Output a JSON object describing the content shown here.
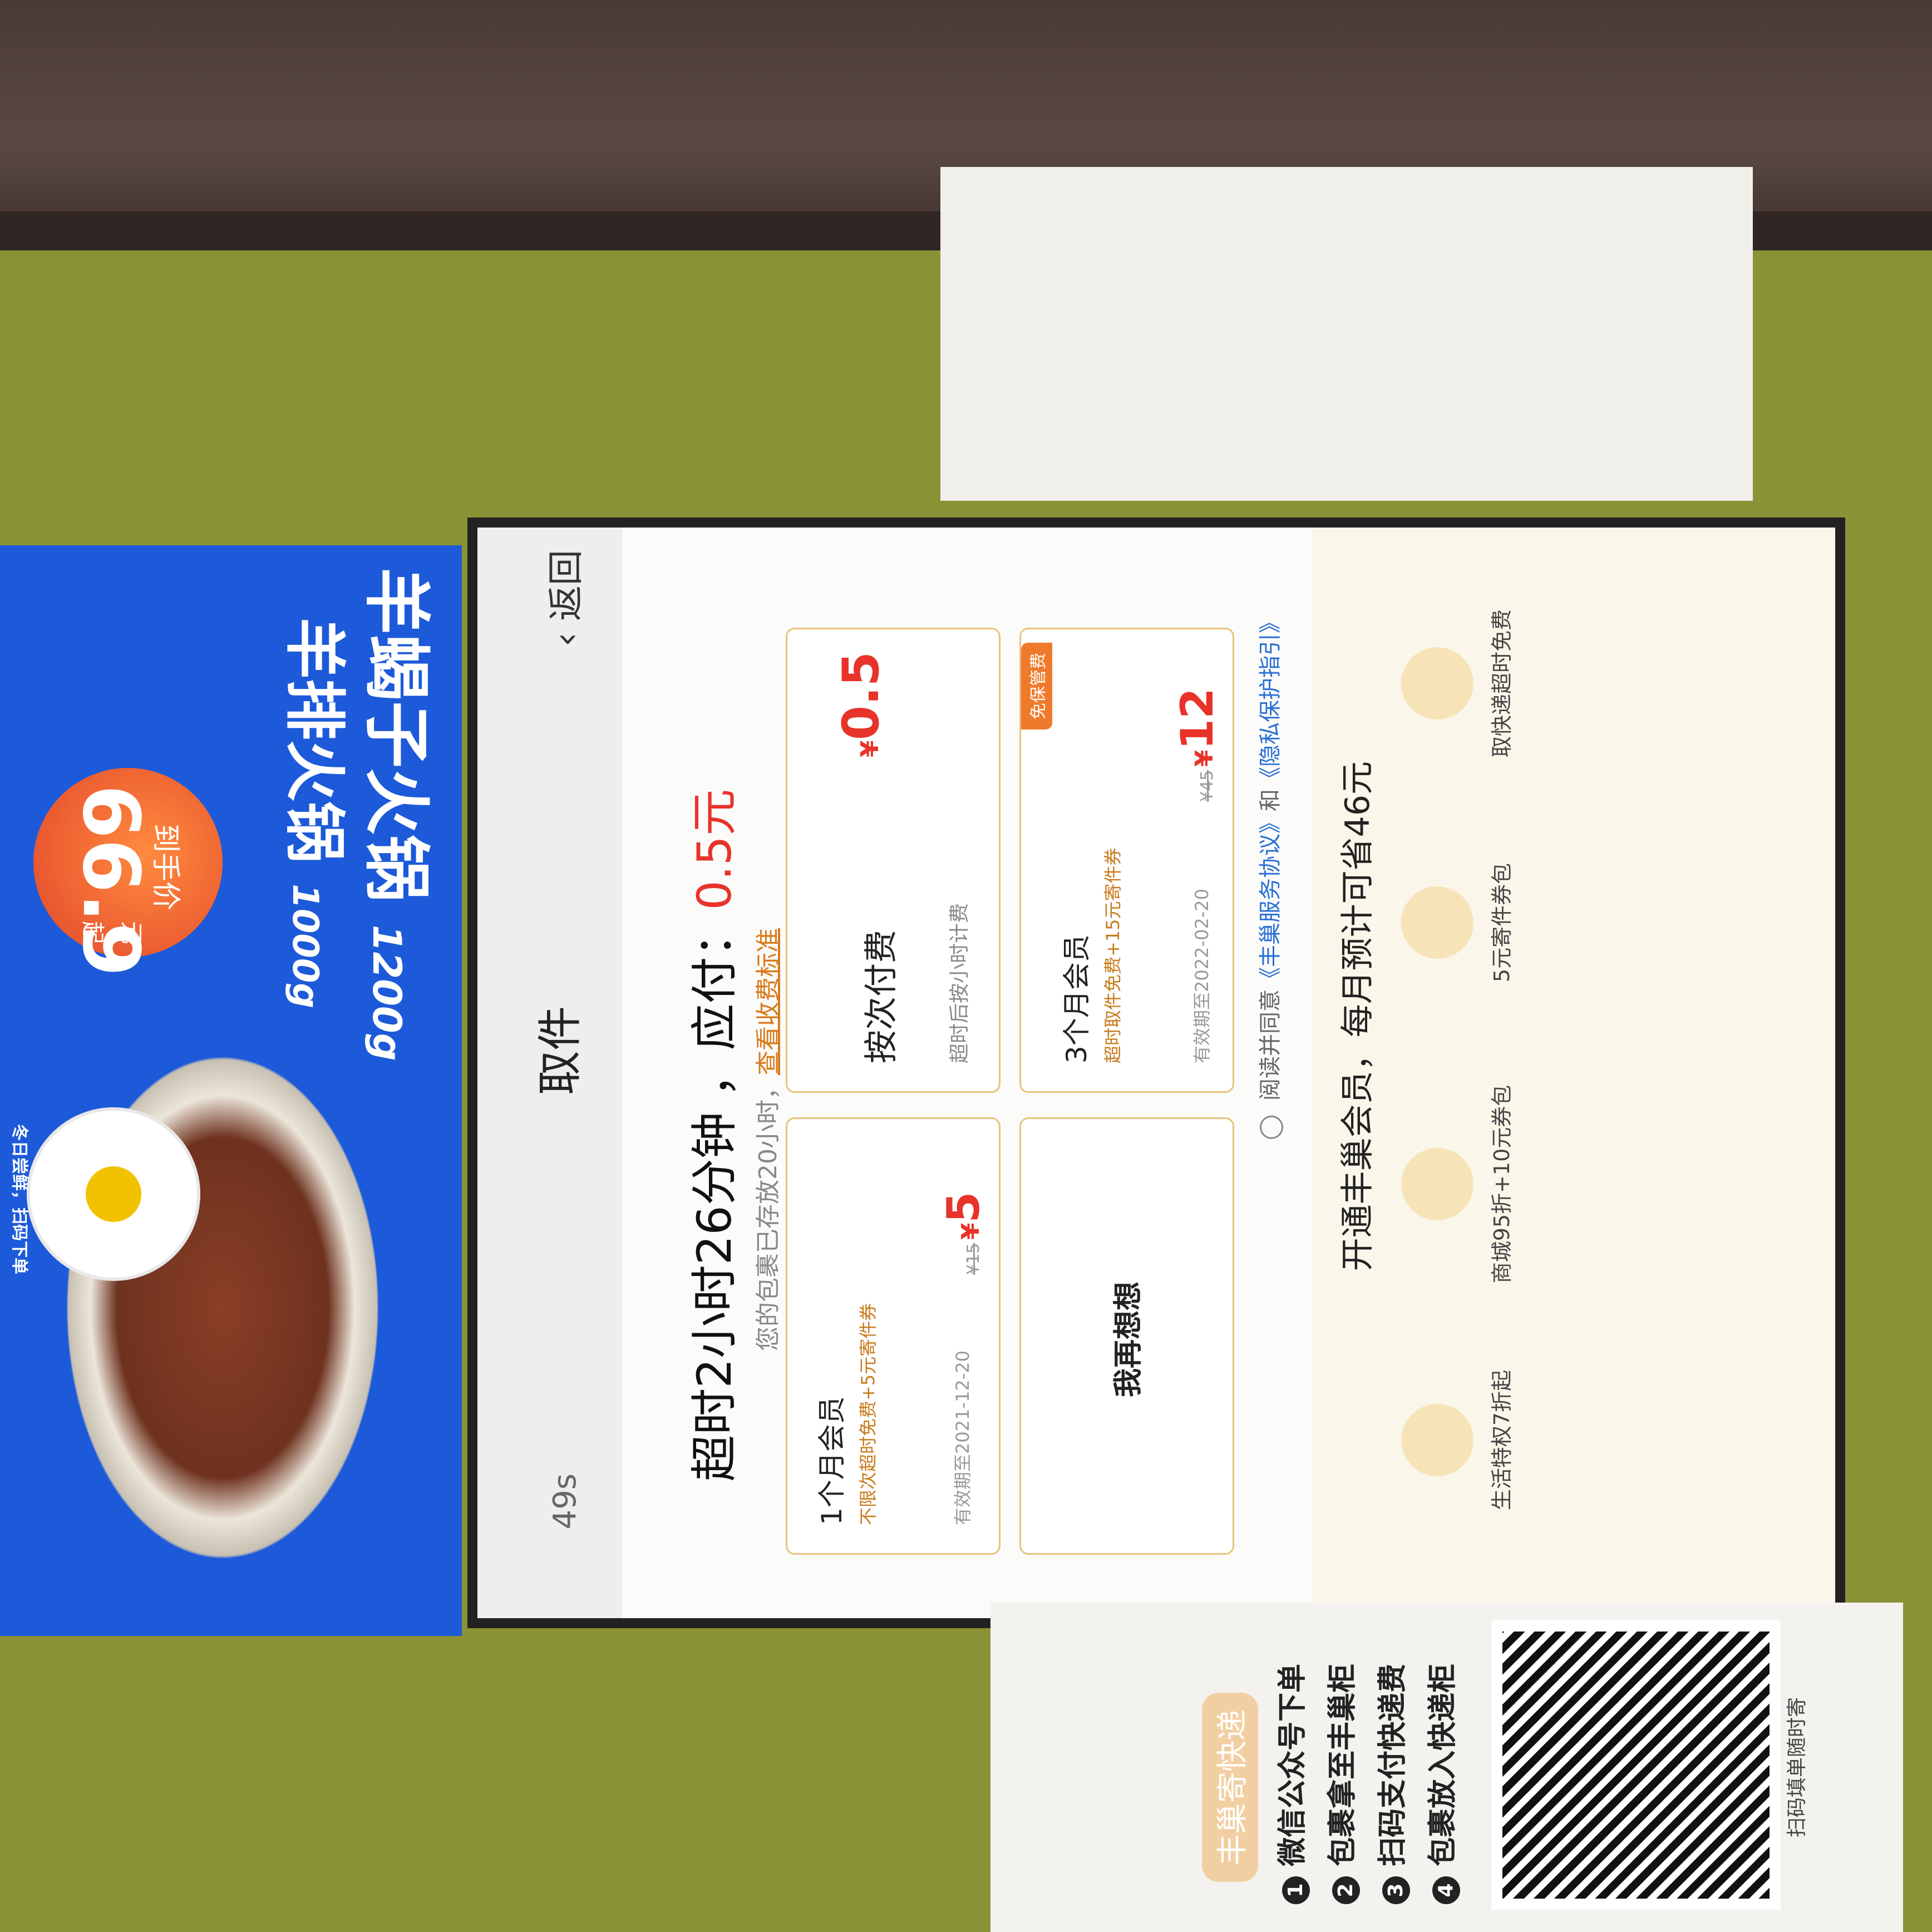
{
  "ad": {
    "title_1": "羊蝎子火锅",
    "weight_1": "1200g",
    "title_2": "羊排火锅",
    "weight_2": "1000g",
    "price_label": "到手价",
    "price": "66.9",
    "price_unit": "元",
    "price_suffix": "起",
    "qr_caption": "冬日尝鲜，扫码下单"
  },
  "kiosk": {
    "back_label": "返回",
    "title": "取件",
    "countdown": "49s",
    "overtime_text": "超时2小时26分钟 ，应付：",
    "amount_due": "0.5元",
    "stored_note": "您的包裹已存放20小时，",
    "fee_standard_link": "查看收费标准",
    "options": [
      {
        "title": "按次付费",
        "desc": "超时后按小时计费",
        "currency": "¥",
        "price": "0.5"
      },
      {
        "title": "1个月会员",
        "desc": "不限次超时免费+5元寄件券",
        "validity": "有效期至2021-12-20",
        "original": "¥15",
        "currency": "¥",
        "price": "5"
      },
      {
        "title": "3个月会员",
        "desc": "超时取件免费+15元寄件券",
        "validity": "有效期至2022-02-20",
        "original": "¥45",
        "currency": "¥",
        "price": "12",
        "badge": "免保管费"
      },
      {
        "title": "我再想想"
      }
    ],
    "agreement_prefix": "阅读并同意",
    "agreement_service": "《丰巢服务协议》",
    "agreement_and": "和",
    "agreement_privacy": "《隐私保护指引》",
    "promo_title": "开通丰巢会员，每月预计可省46元",
    "benefits": [
      {
        "label": "取快递超时免费",
        "icon": "package-icon"
      },
      {
        "label": "5元寄件券包",
        "icon": "coupon-icon"
      },
      {
        "label": "商城95折+10元券包",
        "icon": "discount-icon"
      },
      {
        "label": "生活特权7折起",
        "icon": "gift-icon"
      }
    ]
  },
  "poster": {
    "badge": "丰巢寄快递",
    "steps": [
      "微信公众号下单",
      "包裹拿至丰巢柜",
      "扫码支付快递费",
      "包裹放入快递柜"
    ],
    "qr_caption": "扫码填单随时寄"
  },
  "colors": {
    "accent_red": "#e8332a",
    "link_orange": "#d97a1a",
    "card_border": "#e9c27a",
    "link_blue": "#2a6fd6",
    "ad_blue": "#1d5ad9"
  }
}
